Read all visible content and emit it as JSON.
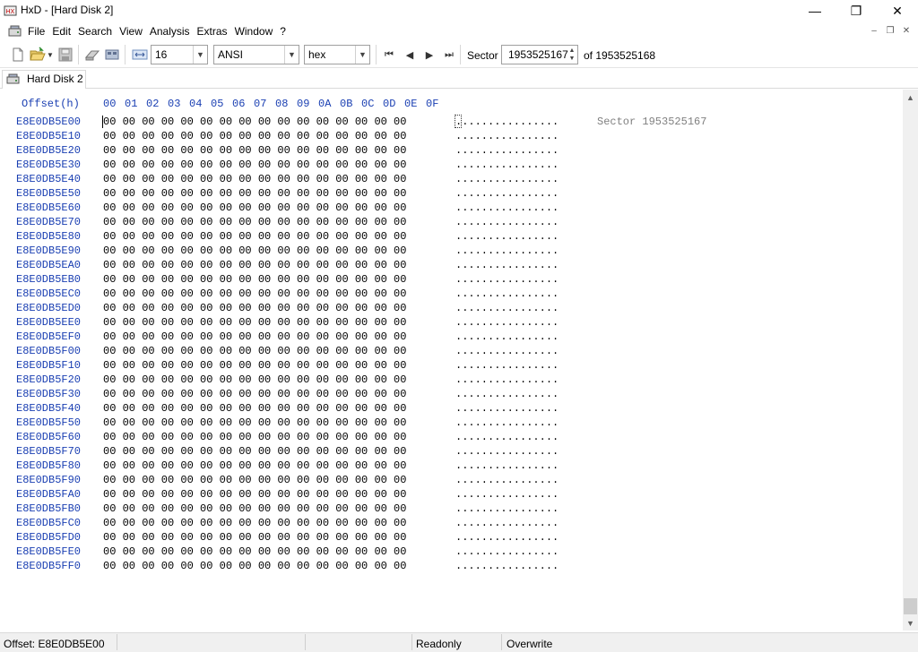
{
  "window": {
    "title": "HxD - [Hard Disk 2]",
    "controls": {
      "minimize": "—",
      "maximize": "❐",
      "close": "✕"
    }
  },
  "menu": {
    "items": [
      "File",
      "Edit",
      "Search",
      "View",
      "Analysis",
      "Extras",
      "Window",
      "?"
    ],
    "mdi_controls": {
      "minimize": "–",
      "restore": "❐",
      "close": "✕"
    }
  },
  "toolbar": {
    "bytes_per_row": "16",
    "charset": "ANSI",
    "offset_base": "hex",
    "sector_label": "Sector",
    "sector_value": "1953525167",
    "sector_total": "of 1953525168",
    "icons": [
      "new-file-icon",
      "open-folder-icon",
      "save-icon",
      "disk-icon",
      "ram-icon",
      "columns-icon",
      "first-sector-icon",
      "previous-sector-icon",
      "next-sector-icon",
      "last-sector-icon"
    ]
  },
  "tabs": [
    {
      "label": "Hard Disk 2",
      "icon": "hard-disk-icon"
    }
  ],
  "editor": {
    "offset_header": "Offset(h)",
    "columns": [
      "00",
      "01",
      "02",
      "03",
      "04",
      "05",
      "06",
      "07",
      "08",
      "09",
      "0A",
      "0B",
      "0C",
      "0D",
      "0E",
      "0F"
    ],
    "sector_annotation": "Sector 1953525167",
    "rows": [
      {
        "offset": "E8E0DB5E00",
        "bytes": "00 00 00 00 00 00 00 00 00 00 00 00 00 00 00 00",
        "ascii": "................"
      },
      {
        "offset": "E8E0DB5E10",
        "bytes": "00 00 00 00 00 00 00 00 00 00 00 00 00 00 00 00",
        "ascii": "................"
      },
      {
        "offset": "E8E0DB5E20",
        "bytes": "00 00 00 00 00 00 00 00 00 00 00 00 00 00 00 00",
        "ascii": "................"
      },
      {
        "offset": "E8E0DB5E30",
        "bytes": "00 00 00 00 00 00 00 00 00 00 00 00 00 00 00 00",
        "ascii": "................"
      },
      {
        "offset": "E8E0DB5E40",
        "bytes": "00 00 00 00 00 00 00 00 00 00 00 00 00 00 00 00",
        "ascii": "................"
      },
      {
        "offset": "E8E0DB5E50",
        "bytes": "00 00 00 00 00 00 00 00 00 00 00 00 00 00 00 00",
        "ascii": "................"
      },
      {
        "offset": "E8E0DB5E60",
        "bytes": "00 00 00 00 00 00 00 00 00 00 00 00 00 00 00 00",
        "ascii": "................"
      },
      {
        "offset": "E8E0DB5E70",
        "bytes": "00 00 00 00 00 00 00 00 00 00 00 00 00 00 00 00",
        "ascii": "................"
      },
      {
        "offset": "E8E0DB5E80",
        "bytes": "00 00 00 00 00 00 00 00 00 00 00 00 00 00 00 00",
        "ascii": "................"
      },
      {
        "offset": "E8E0DB5E90",
        "bytes": "00 00 00 00 00 00 00 00 00 00 00 00 00 00 00 00",
        "ascii": "................"
      },
      {
        "offset": "E8E0DB5EA0",
        "bytes": "00 00 00 00 00 00 00 00 00 00 00 00 00 00 00 00",
        "ascii": "................"
      },
      {
        "offset": "E8E0DB5EB0",
        "bytes": "00 00 00 00 00 00 00 00 00 00 00 00 00 00 00 00",
        "ascii": "................"
      },
      {
        "offset": "E8E0DB5EC0",
        "bytes": "00 00 00 00 00 00 00 00 00 00 00 00 00 00 00 00",
        "ascii": "................"
      },
      {
        "offset": "E8E0DB5ED0",
        "bytes": "00 00 00 00 00 00 00 00 00 00 00 00 00 00 00 00",
        "ascii": "................"
      },
      {
        "offset": "E8E0DB5EE0",
        "bytes": "00 00 00 00 00 00 00 00 00 00 00 00 00 00 00 00",
        "ascii": "................"
      },
      {
        "offset": "E8E0DB5EF0",
        "bytes": "00 00 00 00 00 00 00 00 00 00 00 00 00 00 00 00",
        "ascii": "................"
      },
      {
        "offset": "E8E0DB5F00",
        "bytes": "00 00 00 00 00 00 00 00 00 00 00 00 00 00 00 00",
        "ascii": "................"
      },
      {
        "offset": "E8E0DB5F10",
        "bytes": "00 00 00 00 00 00 00 00 00 00 00 00 00 00 00 00",
        "ascii": "................"
      },
      {
        "offset": "E8E0DB5F20",
        "bytes": "00 00 00 00 00 00 00 00 00 00 00 00 00 00 00 00",
        "ascii": "................"
      },
      {
        "offset": "E8E0DB5F30",
        "bytes": "00 00 00 00 00 00 00 00 00 00 00 00 00 00 00 00",
        "ascii": "................"
      },
      {
        "offset": "E8E0DB5F40",
        "bytes": "00 00 00 00 00 00 00 00 00 00 00 00 00 00 00 00",
        "ascii": "................"
      },
      {
        "offset": "E8E0DB5F50",
        "bytes": "00 00 00 00 00 00 00 00 00 00 00 00 00 00 00 00",
        "ascii": "................"
      },
      {
        "offset": "E8E0DB5F60",
        "bytes": "00 00 00 00 00 00 00 00 00 00 00 00 00 00 00 00",
        "ascii": "................"
      },
      {
        "offset": "E8E0DB5F70",
        "bytes": "00 00 00 00 00 00 00 00 00 00 00 00 00 00 00 00",
        "ascii": "................"
      },
      {
        "offset": "E8E0DB5F80",
        "bytes": "00 00 00 00 00 00 00 00 00 00 00 00 00 00 00 00",
        "ascii": "................"
      },
      {
        "offset": "E8E0DB5F90",
        "bytes": "00 00 00 00 00 00 00 00 00 00 00 00 00 00 00 00",
        "ascii": "................"
      },
      {
        "offset": "E8E0DB5FA0",
        "bytes": "00 00 00 00 00 00 00 00 00 00 00 00 00 00 00 00",
        "ascii": "................"
      },
      {
        "offset": "E8E0DB5FB0",
        "bytes": "00 00 00 00 00 00 00 00 00 00 00 00 00 00 00 00",
        "ascii": "................"
      },
      {
        "offset": "E8E0DB5FC0",
        "bytes": "00 00 00 00 00 00 00 00 00 00 00 00 00 00 00 00",
        "ascii": "................"
      },
      {
        "offset": "E8E0DB5FD0",
        "bytes": "00 00 00 00 00 00 00 00 00 00 00 00 00 00 00 00",
        "ascii": "................"
      },
      {
        "offset": "E8E0DB5FE0",
        "bytes": "00 00 00 00 00 00 00 00 00 00 00 00 00 00 00 00",
        "ascii": "................"
      },
      {
        "offset": "E8E0DB5FF0",
        "bytes": "00 00 00 00 00 00 00 00 00 00 00 00 00 00 00 00",
        "ascii": "................"
      }
    ]
  },
  "status": {
    "offset": "Offset: E8E0DB5E00",
    "mode_readonly": "Readonly",
    "mode_write": "Overwrite"
  },
  "colors": {
    "offset_blue": "#1a3fb2",
    "sector_gray": "#808080"
  }
}
